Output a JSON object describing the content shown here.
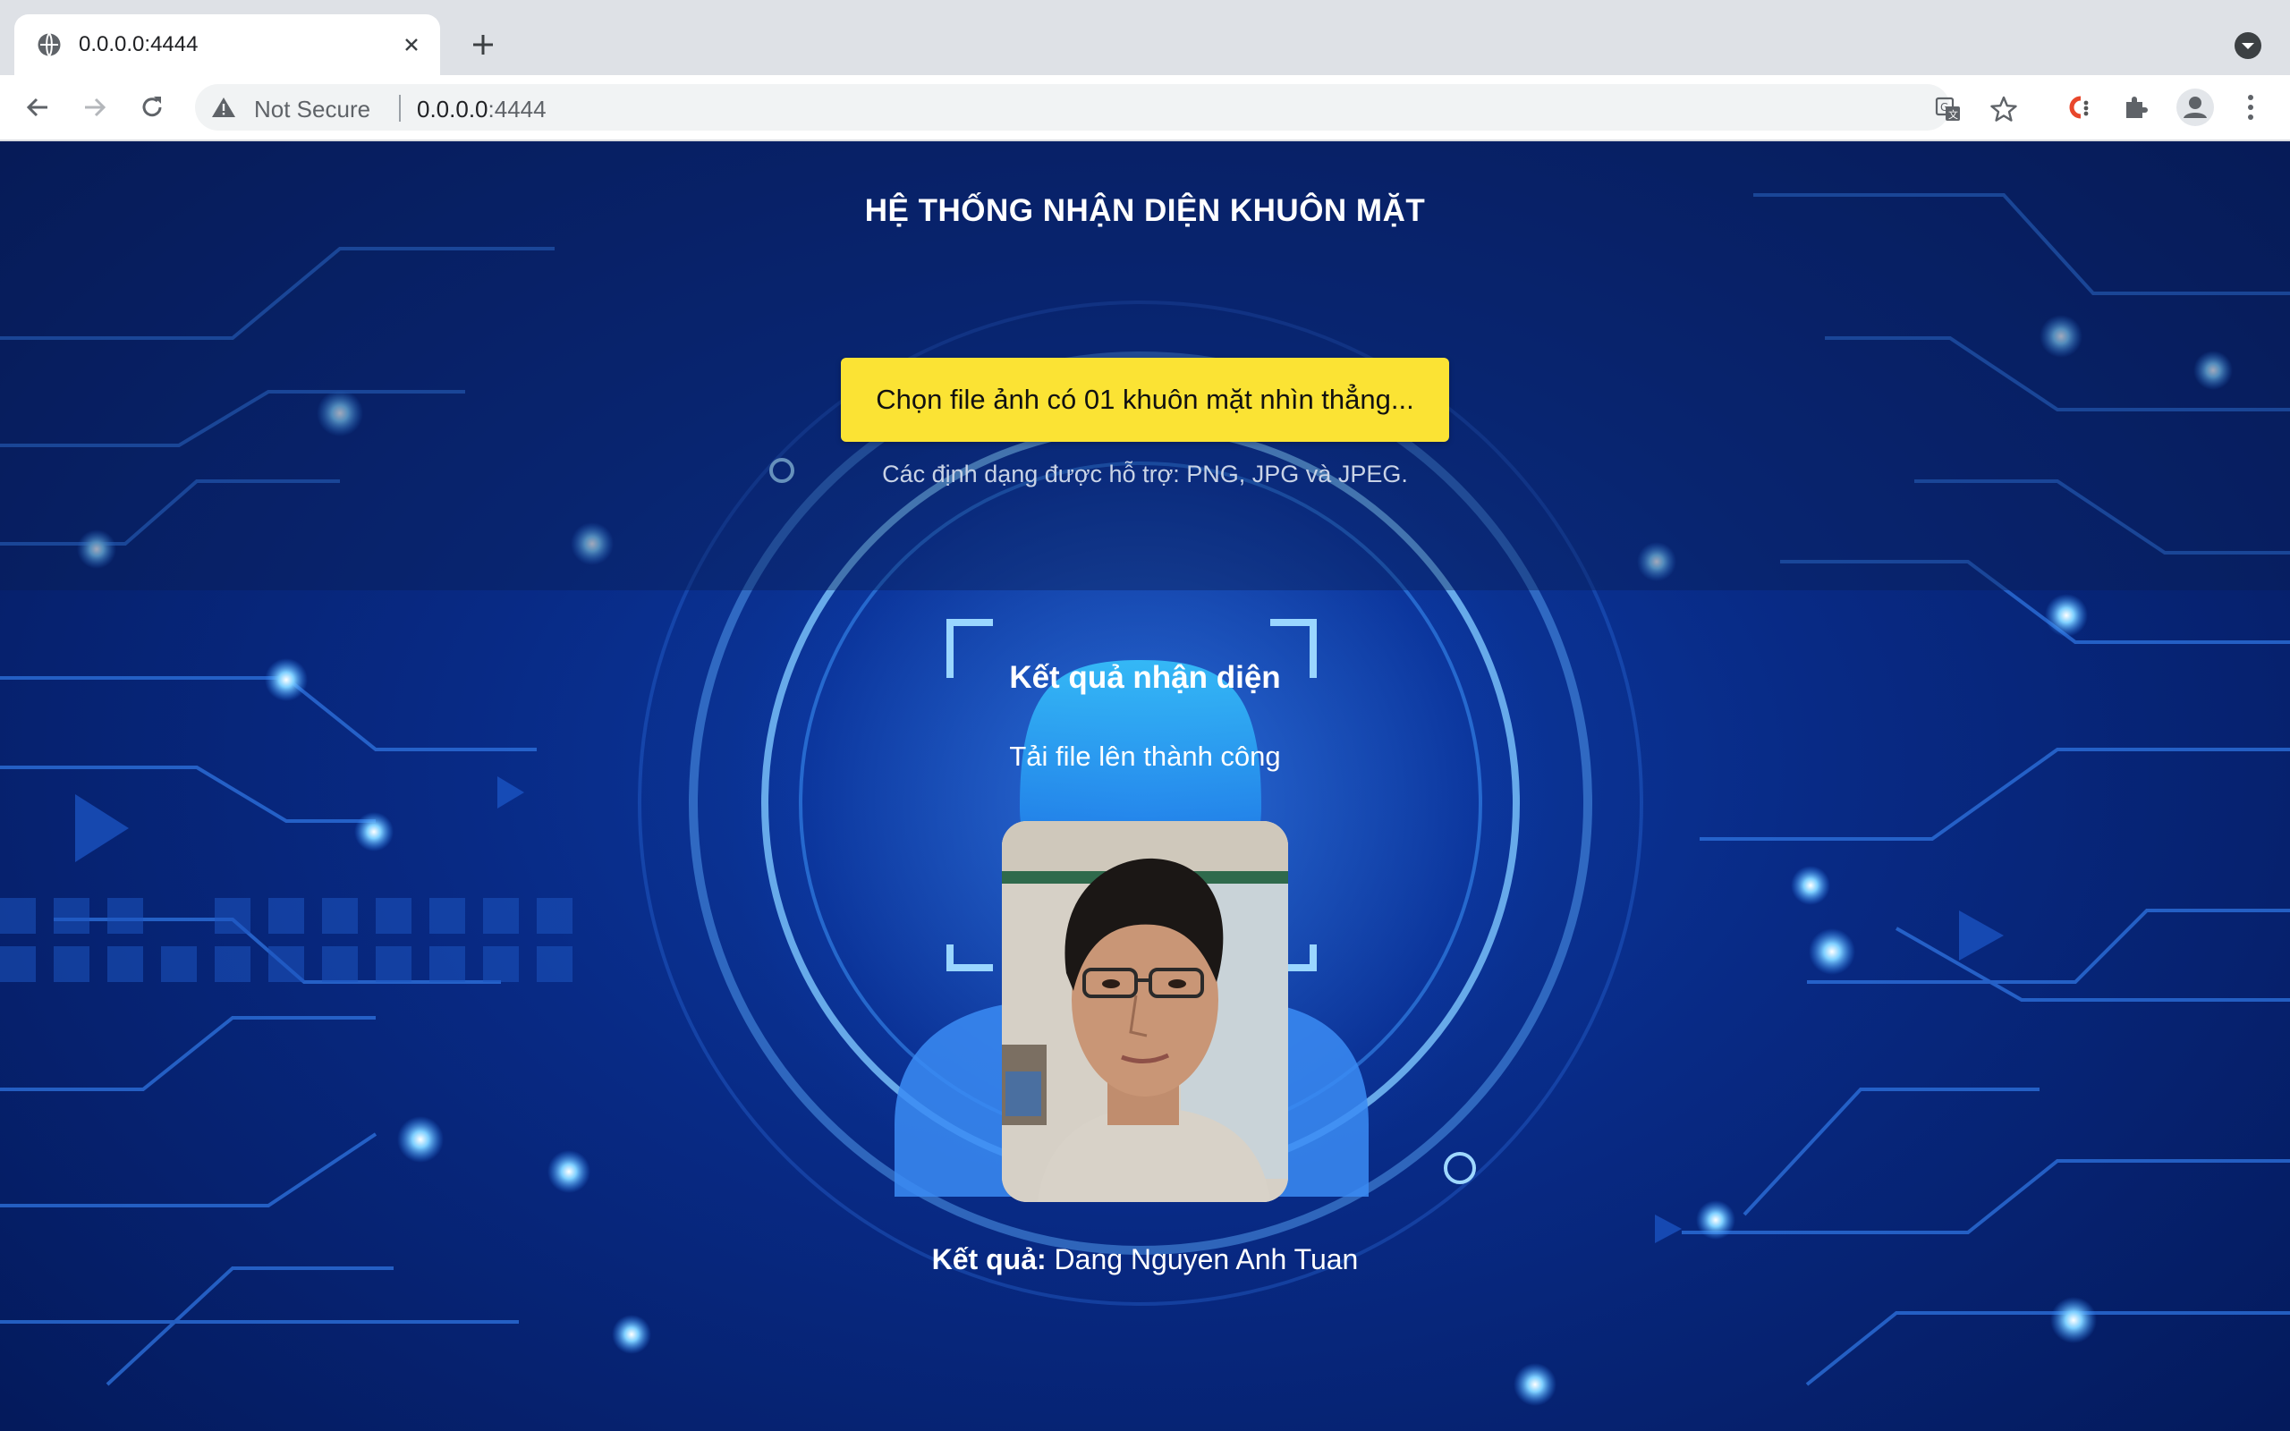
{
  "browser": {
    "tab_title": "0.0.0.0:4444",
    "security_label": "Not Secure",
    "url_host": "0.0.0.0",
    "url_port": ":4444"
  },
  "page": {
    "heading": "HỆ THỐNG NHẬN DIỆN KHUÔN MẶT",
    "upload_button": "Chọn file ảnh có 01 khuôn mặt nhìn thẳng...",
    "formats_note": "Các định dạng được hỗ trợ: PNG, JPG và JPEG.",
    "result_heading": "Kết quả nhận diện",
    "status_message": "Tải file lên thành công",
    "result_label": "Kết quả:",
    "result_value": " Dang Nguyen Anh Tuan"
  },
  "icons": [
    "globe-icon",
    "close-icon",
    "plus-icon",
    "tab-search-icon",
    "back-icon",
    "forward-icon",
    "reload-icon",
    "warning-icon",
    "translate-icon",
    "star-icon",
    "extension-c-icon",
    "puzzle-icon",
    "profile-icon",
    "menu-icon"
  ],
  "colors": {
    "upload_button_bg": "#fbe334",
    "page_bg": "#082a85",
    "accent_glow": "#4fb4ff"
  }
}
